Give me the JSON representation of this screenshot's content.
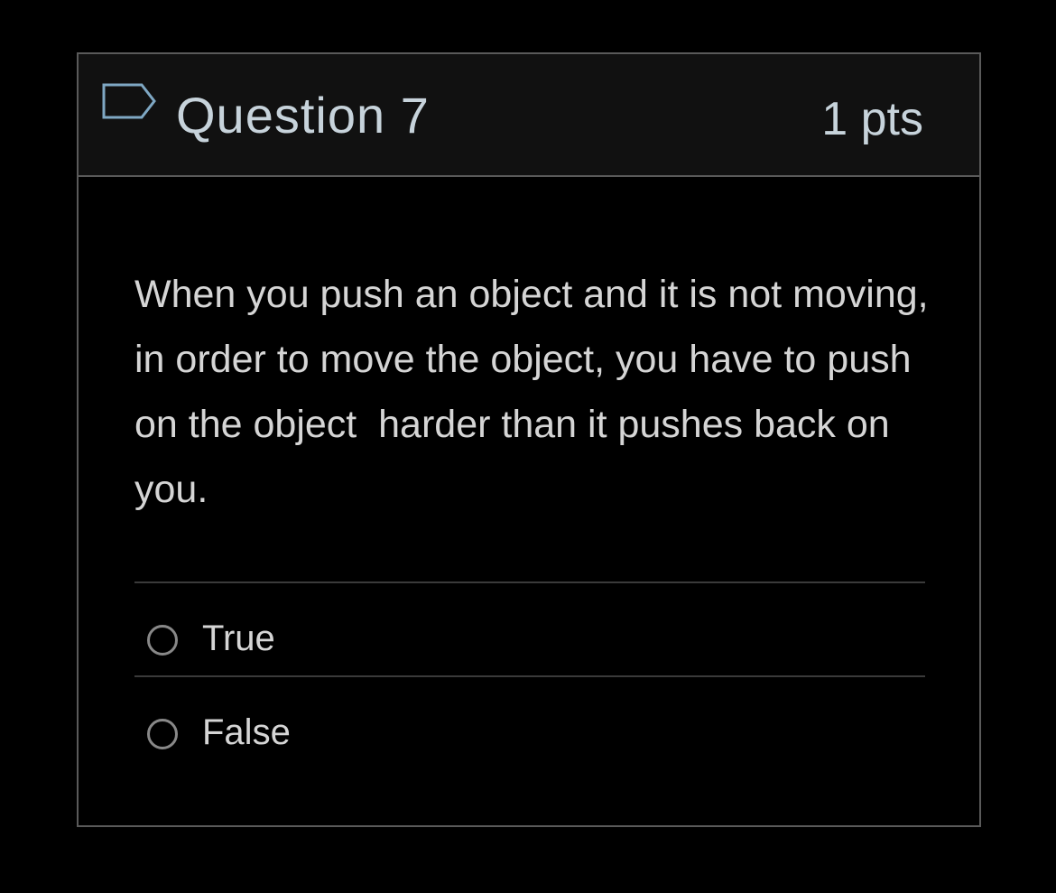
{
  "question": {
    "title": "Question 7",
    "points": "1 pts",
    "flag_icon": "flag-outline-icon",
    "text": "When you push an object and it is not moving, in order to move the object, you have to push on the object  harder than it pushes back on you."
  },
  "answers": [
    {
      "label": "True",
      "selected": false
    },
    {
      "label": "False",
      "selected": false
    }
  ],
  "colors": {
    "background": "#000000",
    "header_background": "#111111",
    "border": "#5a5a5a",
    "title_text": "#c7d3db",
    "body_text": "#d5d5d5",
    "flag_stroke": "#7fa8c4",
    "radio_border": "#888888"
  }
}
